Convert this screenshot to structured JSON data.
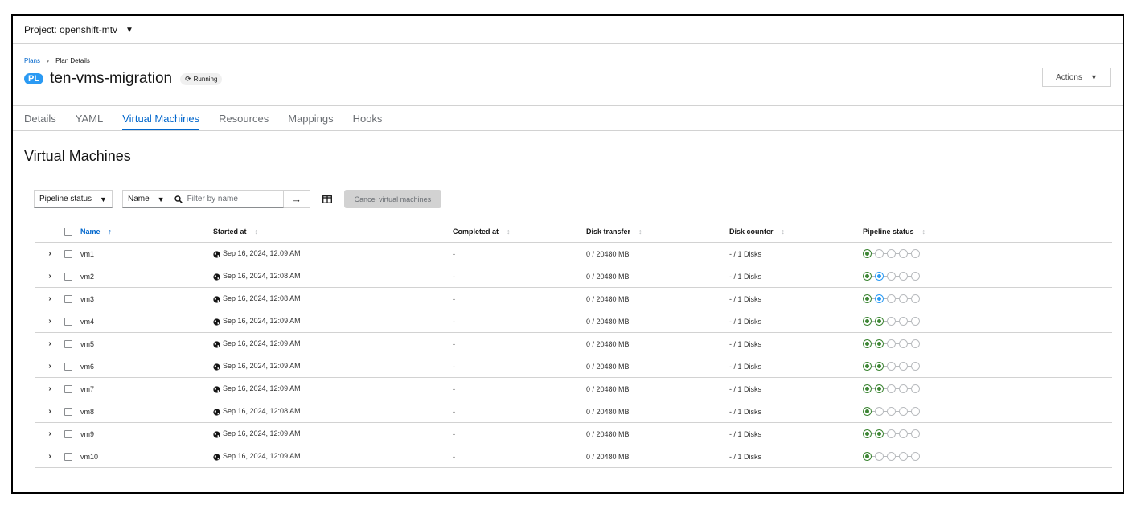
{
  "project": {
    "label": "Project: openshift-mtv"
  },
  "breadcrumb": {
    "parent": "Plans",
    "current": "Plan Details"
  },
  "plan": {
    "badge": "PL",
    "name": "ten-vms-migration",
    "status": "Running"
  },
  "actions": {
    "label": "Actions"
  },
  "tabs": [
    {
      "label": "Details"
    },
    {
      "label": "YAML"
    },
    {
      "label": "Virtual Machines"
    },
    {
      "label": "Resources"
    },
    {
      "label": "Mappings"
    },
    {
      "label": "Hooks"
    }
  ],
  "section": {
    "title": "Virtual Machines"
  },
  "toolbar": {
    "pipeline_filter": "Pipeline status",
    "name_filter": "Name",
    "search_placeholder": "Filter by name",
    "cancel_label": "Cancel virtual machines"
  },
  "table": {
    "columns": {
      "name": "Name",
      "started": "Started at",
      "completed": "Completed at",
      "disk_transfer": "Disk transfer",
      "disk_counter": "Disk counter",
      "pipeline": "Pipeline status"
    },
    "rows": [
      {
        "name": "vm1",
        "started": "Sep 16, 2024, 12:09 AM",
        "completed": "-",
        "disk_transfer": "0 / 20480 MB",
        "disk_counter": "- / 1 Disks",
        "pipeline": [
          "done",
          "pending",
          "pending",
          "pending",
          "pending"
        ]
      },
      {
        "name": "vm2",
        "started": "Sep 16, 2024, 12:08 AM",
        "completed": "-",
        "disk_transfer": "0 / 20480 MB",
        "disk_counter": "- / 1 Disks",
        "pipeline": [
          "done",
          "active",
          "pending",
          "pending",
          "pending"
        ]
      },
      {
        "name": "vm3",
        "started": "Sep 16, 2024, 12:08 AM",
        "completed": "-",
        "disk_transfer": "0 / 20480 MB",
        "disk_counter": "- / 1 Disks",
        "pipeline": [
          "done",
          "active",
          "pending",
          "pending",
          "pending"
        ]
      },
      {
        "name": "vm4",
        "started": "Sep 16, 2024, 12:09 AM",
        "completed": "-",
        "disk_transfer": "0 / 20480 MB",
        "disk_counter": "- / 1 Disks",
        "pipeline": [
          "done",
          "done",
          "pending",
          "pending",
          "pending"
        ]
      },
      {
        "name": "vm5",
        "started": "Sep 16, 2024, 12:09 AM",
        "completed": "-",
        "disk_transfer": "0 / 20480 MB",
        "disk_counter": "- / 1 Disks",
        "pipeline": [
          "done",
          "done",
          "pending",
          "pending",
          "pending"
        ]
      },
      {
        "name": "vm6",
        "started": "Sep 16, 2024, 12:09 AM",
        "completed": "-",
        "disk_transfer": "0 / 20480 MB",
        "disk_counter": "- / 1 Disks",
        "pipeline": [
          "done",
          "done",
          "pending",
          "pending",
          "pending"
        ]
      },
      {
        "name": "vm7",
        "started": "Sep 16, 2024, 12:09 AM",
        "completed": "-",
        "disk_transfer": "0 / 20480 MB",
        "disk_counter": "- / 1 Disks",
        "pipeline": [
          "done",
          "done",
          "pending",
          "pending",
          "pending"
        ]
      },
      {
        "name": "vm8",
        "started": "Sep 16, 2024, 12:08 AM",
        "completed": "-",
        "disk_transfer": "0 / 20480 MB",
        "disk_counter": "- / 1 Disks",
        "pipeline": [
          "done",
          "pending",
          "pending",
          "pending",
          "pending"
        ]
      },
      {
        "name": "vm9",
        "started": "Sep 16, 2024, 12:09 AM",
        "completed": "-",
        "disk_transfer": "0 / 20480 MB",
        "disk_counter": "- / 1 Disks",
        "pipeline": [
          "done",
          "done",
          "pending",
          "pending",
          "pending"
        ]
      },
      {
        "name": "vm10",
        "started": "Sep 16, 2024, 12:09 AM",
        "completed": "-",
        "disk_transfer": "0 / 20480 MB",
        "disk_counter": "- / 1 Disks",
        "pipeline": [
          "done",
          "pending",
          "pending",
          "pending",
          "pending"
        ]
      }
    ]
  },
  "colors": {
    "accent": "#0066cc",
    "success": "#3e8635",
    "running": "#2b9af3",
    "badge": "#2b9af3"
  }
}
